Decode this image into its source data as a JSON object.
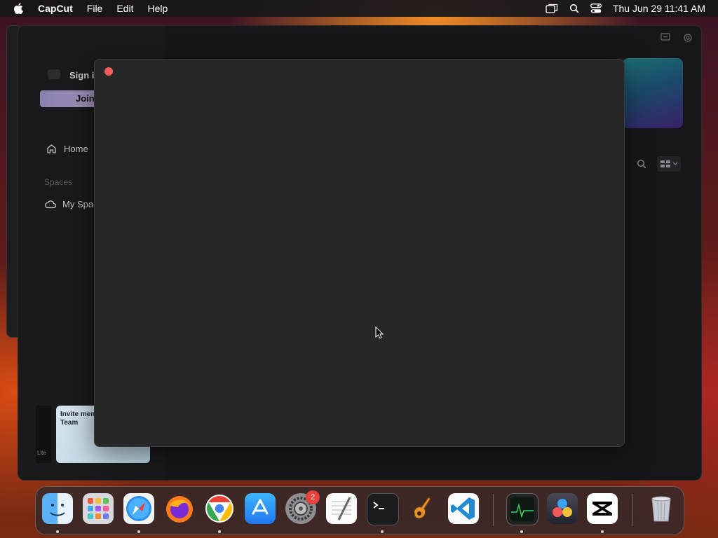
{
  "menubar": {
    "app_name": "CapCut",
    "menus": [
      "File",
      "Edit",
      "Help"
    ],
    "clock": "Thu Jun 29  11:41 AM"
  },
  "sidebar": {
    "sign_in": "Sign in",
    "join": "Join",
    "home": "Home",
    "spaces_label": "Spaces",
    "my_space": "My Space",
    "invite_card": "Invite members to Space Team",
    "thumb_label": "Lite"
  },
  "dock": {
    "apps": [
      "Finder",
      "Launchpad",
      "Safari",
      "Firefox",
      "Chrome",
      "App Store",
      "System Settings",
      "TextEdit",
      "Terminal",
      "GarageBand",
      "Visual Studio Code",
      "Activity Monitor",
      "DaVinci Resolve",
      "CapCut",
      "Trash"
    ],
    "settings_badge": "2"
  },
  "colors": {
    "modal_bg": "#272727",
    "close_button": "#ef5e5a",
    "window_bg": "#17171a"
  }
}
